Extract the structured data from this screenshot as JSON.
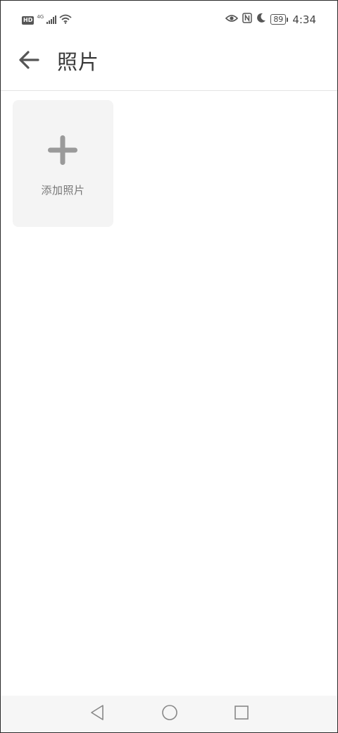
{
  "status_bar": {
    "hd_badge": "HD",
    "network": "4G",
    "battery": "89",
    "time": "4:34",
    "icons": [
      "signal-icon",
      "wifi-icon",
      "eye-icon",
      "nfc-icon",
      "moon-icon",
      "battery-icon"
    ]
  },
  "app_bar": {
    "title": "照片",
    "back_icon": "arrow-left-icon"
  },
  "add_tile": {
    "label": "添加照片",
    "icon": "plus-icon"
  },
  "nav_bar": {
    "icons": [
      "back-triangle-icon",
      "home-circle-icon",
      "recents-square-icon"
    ]
  },
  "colors": {
    "background": "#ffffff",
    "tile_background": "#f4f4f4",
    "icon_gray": "#9a9a9a",
    "text_dark": "#3a3a3a",
    "divider": "#e4e4e4"
  }
}
